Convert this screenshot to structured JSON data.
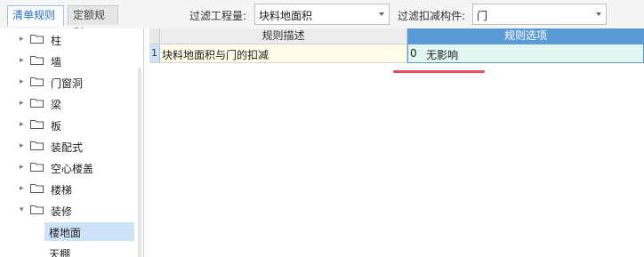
{
  "tabs": {
    "active": "清单规则",
    "inactive": "定额规则"
  },
  "filters": {
    "quantity_label": "过滤工程量:",
    "quantity_value": "块料地面积",
    "component_label": "过滤扣减构件:",
    "component_value": "门"
  },
  "tree": {
    "folders": [
      "柱",
      "墙",
      "门窗洞",
      "梁",
      "板",
      "装配式",
      "空心楼盖",
      "楼梯",
      "装修"
    ],
    "expanded_folder": "装修",
    "leaves": [
      "楼地面",
      "天棚"
    ],
    "selected_leaf": "楼地面"
  },
  "grid": {
    "columns": [
      "规则描述",
      "规则选项"
    ],
    "rows": [
      {
        "num": "1",
        "description": "块料地面积与门的扣减",
        "option_code": "0",
        "option_text": "无影响"
      }
    ]
  },
  "colors": {
    "header_active": "#5b9bd5",
    "selected_row": "#cde3f8",
    "desc_cell": "#fffce8",
    "option_cell": "#e1f7ee",
    "annotation_underline": "#e8485a"
  }
}
